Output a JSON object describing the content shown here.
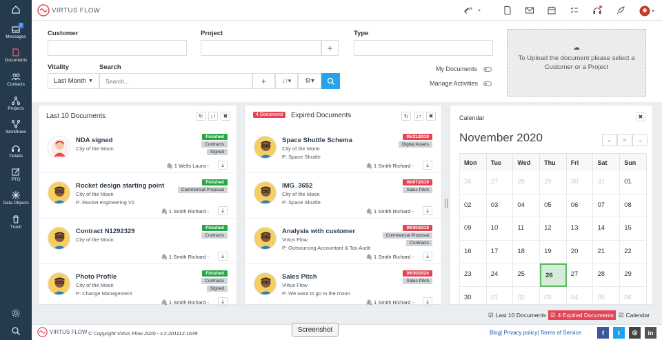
{
  "app": {
    "name": "VIRTUS FLOW",
    "accent": "#e44556",
    "sidebar_bg": "#263a4d"
  },
  "sidebar": {
    "messages_badge": "1",
    "items": [
      {
        "label": "",
        "icon": "home-icon"
      },
      {
        "label": "Messages",
        "icon": "inbox-icon"
      },
      {
        "label": "Documents",
        "icon": "document-icon"
      },
      {
        "label": "Contacts",
        "icon": "contacts-icon"
      },
      {
        "label": "Projects",
        "icon": "projects-icon"
      },
      {
        "label": "Workflows",
        "icon": "workflow-icon"
      },
      {
        "label": "Tickets",
        "icon": "headset-icon"
      },
      {
        "label": "PTO",
        "icon": "edit-icon"
      },
      {
        "label": "Data Objects",
        "icon": "asterisk-icon"
      },
      {
        "label": "Trash",
        "icon": "trash-icon"
      }
    ]
  },
  "filters": {
    "customer_label": "Customer",
    "project_label": "Project",
    "type_label": "Type",
    "vitality_label": "Vitality",
    "vitality_value": "Last Month",
    "search_label": "Search",
    "search_placeholder": "Search...",
    "my_documents_label": "My Documents",
    "manage_activities_label": "Manage Activities"
  },
  "upload": {
    "text_line1": "To Upload the document please select a",
    "text_line2": "Customer or a Project"
  },
  "last_docs": {
    "title": "Last 10 Documents",
    "items": [
      {
        "name": "NDA signed",
        "sub1": "City of the Moon",
        "sub2": "",
        "tags": [
          [
            "Finished",
            "green"
          ],
          [
            "Contracts",
            ""
          ],
          [
            "Signed",
            ""
          ]
        ],
        "owner": "Wells Laura -"
      },
      {
        "name": "Rocket design starting point",
        "sub1": "City of the Moon",
        "sub2": "P: Rocket engineering V2",
        "tags": [
          [
            "Finished",
            "green"
          ],
          [
            "Commercial Proposal",
            ""
          ]
        ],
        "owner": "Smith Richard -"
      },
      {
        "name": "Contract N1292329",
        "sub1": "City of the Moon",
        "sub2": "",
        "tags": [
          [
            "Finished",
            "green"
          ],
          [
            "Contracts",
            ""
          ]
        ],
        "owner": "Smith Richard -"
      },
      {
        "name": "Photo Profile",
        "sub1": "City of the Moon",
        "sub2": "P: Change Management",
        "tags": [
          [
            "Finished",
            "green"
          ],
          [
            "Contracts",
            ""
          ],
          [
            "Signed",
            ""
          ]
        ],
        "owner": "Smith Richard -"
      }
    ]
  },
  "expired_docs": {
    "badge": "4 Documenti",
    "title": "Expired Documents",
    "items": [
      {
        "name": "Space Shuttle Schema",
        "sub1": "City of the Moon",
        "sub2": "P: Space Shuttle",
        "tags": [
          [
            "05/31/2019",
            "red"
          ],
          [
            "Digital Assets",
            ""
          ]
        ],
        "owner": "Smith Richard -"
      },
      {
        "name": "IMG_3652",
        "sub1": "City of the Moon",
        "sub2": "P: Space Shuttle",
        "tags": [
          [
            "06/07/2019",
            "red"
          ],
          [
            "Sales Pitch",
            ""
          ]
        ],
        "owner": "Smith Richard -"
      },
      {
        "name": "Analysis with customer",
        "sub1": "Virtus Flow",
        "sub2": "P: Outsourcing Accountant & Tax Audit",
        "tags": [
          [
            "09/30/2019",
            "red"
          ],
          [
            "Commercial Proposal",
            ""
          ],
          [
            "Contracts",
            ""
          ]
        ],
        "owner": "Smith Richard -"
      },
      {
        "name": "Sales Pitch",
        "sub1": "Virtus Flow",
        "sub2": "P: We want to go to the moon",
        "tags": [
          [
            "09/30/2020",
            "red"
          ],
          [
            "Sales Pitch",
            ""
          ]
        ],
        "owner": "Smith Richard -"
      }
    ]
  },
  "calendar": {
    "title": "Calendar",
    "month": "November 2020",
    "weekdays": [
      "Mon",
      "Tue",
      "Wed",
      "Thu",
      "Fri",
      "Sat",
      "Sun"
    ],
    "weeks": [
      [
        [
          "26",
          1
        ],
        [
          "27",
          1
        ],
        [
          "28",
          1
        ],
        [
          "29",
          1
        ],
        [
          "30",
          1
        ],
        [
          "31",
          1
        ],
        [
          "01",
          0
        ]
      ],
      [
        [
          "02",
          0
        ],
        [
          "03",
          0
        ],
        [
          "04",
          0
        ],
        [
          "05",
          0
        ],
        [
          "06",
          0
        ],
        [
          "07",
          0
        ],
        [
          "08",
          0
        ]
      ],
      [
        [
          "09",
          0
        ],
        [
          "10",
          0
        ],
        [
          "11",
          0
        ],
        [
          "12",
          0
        ],
        [
          "13",
          0
        ],
        [
          "14",
          0
        ],
        [
          "15",
          0
        ]
      ],
      [
        [
          "16",
          0
        ],
        [
          "17",
          0
        ],
        [
          "18",
          0
        ],
        [
          "19",
          0
        ],
        [
          "20",
          0
        ],
        [
          "21",
          0
        ],
        [
          "22",
          0
        ]
      ],
      [
        [
          "23",
          0
        ],
        [
          "24",
          0
        ],
        [
          "25",
          0
        ],
        [
          "26",
          2
        ],
        [
          "27",
          0
        ],
        [
          "28",
          0
        ],
        [
          "29",
          0
        ]
      ],
      [
        [
          "30",
          0
        ],
        [
          "01",
          1
        ],
        [
          "02",
          1
        ],
        [
          "03",
          1
        ],
        [
          "04",
          1
        ],
        [
          "05",
          1
        ],
        [
          "06",
          1
        ]
      ]
    ]
  },
  "panel_tabs": {
    "last": "Last 10 Documents",
    "expired": "4 Expired Documents",
    "calendar": "Calendar"
  },
  "tooltip": "Screenshot",
  "footer": {
    "logo": "VIRTUS FLOW",
    "copyright": "© Copyright Virtus Flow 2020 - v.2.201112.1639",
    "links": "Blog| Privacy policy| Terms of Service"
  },
  "social": [
    {
      "icon": "facebook-icon",
      "label": "f",
      "color": "#3b5998"
    },
    {
      "icon": "twitter-icon",
      "label": "t",
      "color": "#1da1f2"
    },
    {
      "icon": "instagram-icon",
      "label": "◎",
      "color": "#444"
    },
    {
      "icon": "linkedin-icon",
      "label": "in",
      "color": "#555"
    }
  ]
}
